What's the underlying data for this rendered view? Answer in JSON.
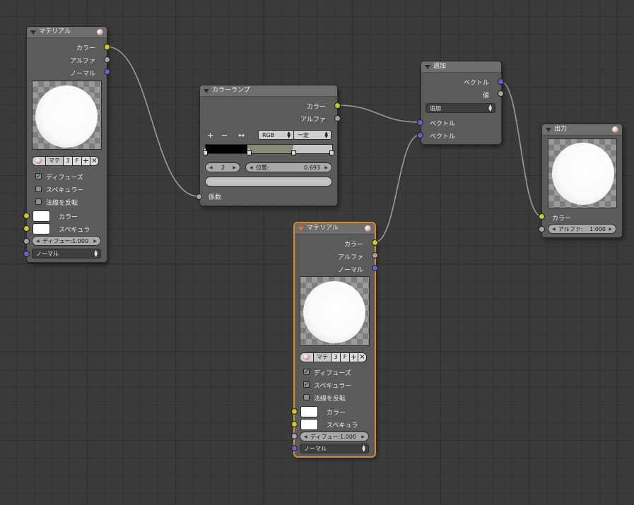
{
  "colors": {
    "background": "#3a3a3a",
    "node_body": "#5b5b5b",
    "node_header": "#6e6e6e",
    "socket_color": "#c8c82a",
    "socket_value": "#a3a3a3",
    "socket_vector": "#6363c7",
    "selected_outline": "#d98b2b",
    "link": "#9a9a9a"
  },
  "nodes": {
    "material1": {
      "title": "マテリアル",
      "outputs": [
        "カラー",
        "アルファ",
        "ノーマル"
      ],
      "material_buttons": {
        "name": "マテ",
        "users": "3",
        "fake": "F",
        "add": "+",
        "remove": "×"
      },
      "checkboxes": [
        {
          "label": "ディフューズ",
          "checked": true,
          "mark": "✓"
        },
        {
          "label": "スペキュラー",
          "checked": false,
          "mark": ""
        },
        {
          "label": "法線を反転",
          "checked": false,
          "mark": ""
        }
      ],
      "inputs": {
        "color_label": "カラー",
        "spec_label": "スペキュラ"
      },
      "diffuse_field": "ディフュー:1.000",
      "normal_dropdown": "ノーマル"
    },
    "colorramp": {
      "title": "カラーランプ",
      "outputs": [
        "カラー",
        "アルファ"
      ],
      "tool_plus": "+",
      "tool_minus": "−",
      "tool_flip": "↔",
      "color_mode": "RGB",
      "interpolation": "一定",
      "active_index": "2",
      "position_label": "位置:",
      "position_value": "0.693",
      "input_label": "係数",
      "stops": [
        0.0,
        0.33,
        0.693,
        1.0
      ]
    },
    "add": {
      "title": "追加",
      "outputs": [
        "ベクトル",
        "値"
      ],
      "operation": "追加",
      "inputs": [
        "ベクトル",
        "ベクトル"
      ]
    },
    "output": {
      "title": "出力",
      "color_label": "カラー",
      "alpha_label": "アルファ:",
      "alpha_value": "1.000"
    },
    "material2": {
      "title": "マテリアル",
      "outputs": [
        "カラー",
        "アルファ",
        "ノーマル"
      ],
      "material_buttons": {
        "name": "マテ",
        "users": "3",
        "fake": "F",
        "add": "+",
        "remove": "×"
      },
      "checkboxes": [
        {
          "label": "ディフューズ",
          "checked": true,
          "mark": "✓"
        },
        {
          "label": "スペキュラー",
          "checked": true,
          "mark": "✓"
        },
        {
          "label": "法線を反転",
          "checked": false,
          "mark": ""
        }
      ],
      "inputs": {
        "color_label": "カラー",
        "spec_label": "スペキュラ"
      },
      "diffuse_field": "ディフュー:1.000",
      "normal_dropdown": "ノーマル"
    }
  },
  "icons": {
    "collapse": "triangle-down-icon",
    "material": "material-sphere-icon",
    "updown": "up-down-arrows-icon"
  }
}
